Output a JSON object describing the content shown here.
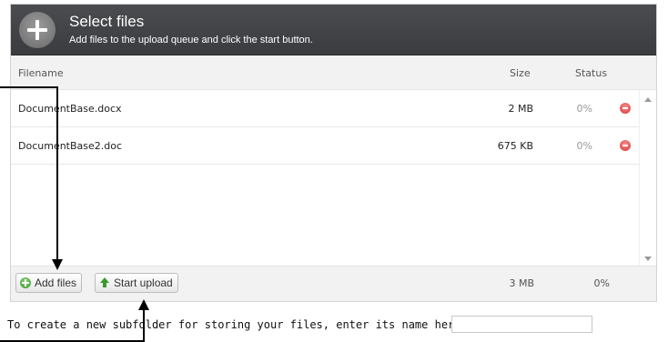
{
  "header": {
    "title": "Select files",
    "subtitle": "Add files to the upload queue and click the start button.",
    "icon": "plus-icon"
  },
  "columns": {
    "filename": "Filename",
    "size": "Size",
    "status": "Status"
  },
  "files": [
    {
      "name": "DocumentBase.docx",
      "size": "2 MB",
      "status": "0%"
    },
    {
      "name": "DocumentBase2.doc",
      "size": "675 KB",
      "status": "0%"
    }
  ],
  "footer": {
    "add_files_label": "Add files",
    "start_upload_label": "Start upload",
    "total_size": "3 MB",
    "total_percent": "0%"
  },
  "subfolder": {
    "prompt": "To create a new subfolder for storing your files, enter its name here:",
    "value": ""
  },
  "colors": {
    "header_bg": "#3f4144",
    "remove": "#d43a3a",
    "add": "#3c9a2a"
  }
}
